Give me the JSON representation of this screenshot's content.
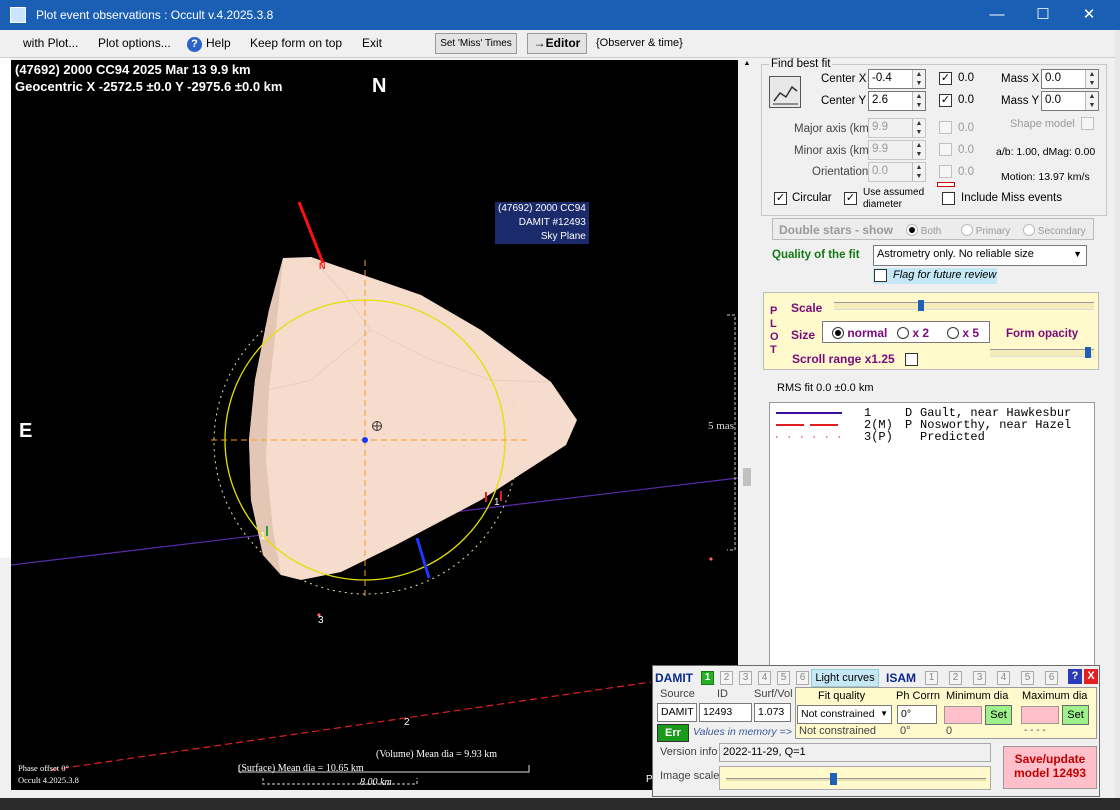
{
  "window": {
    "title": "Plot event observations : Occult v.4.2025.3.8",
    "minimize": "—",
    "maximize": "☐",
    "close": "✕"
  },
  "menu": {
    "with_plot": "with Plot...",
    "plot_options": "Plot options...",
    "help": "Help",
    "keep_on_top": "Keep form on top",
    "exit": "Exit",
    "set_miss_times": "Set 'Miss' Times",
    "editor": "→Editor",
    "observer_time": "{Observer & time}"
  },
  "plot": {
    "header_line1": "(47692) 2000 CC94  2025 Mar 13  9.9 km",
    "header_line2": "Geocentric  X  -2572.5 ±0.0  Y -2975.6 ±0.0 km",
    "north": "N",
    "east": "E",
    "info_line1": "(47692) 2000 CC94",
    "info_line2": "DAMIT #12493",
    "info_line3": "Sky Plane",
    "scale_mas": "5 mas",
    "phase_offset": "Phase offset 0°",
    "occult_version": "Occult 4.2025.3.8",
    "volume_dia": "(Volume) Mean dia = 9.93 km",
    "surface_dia": "(Surface) Mean dia = 10.65 km",
    "scale_km": "8.00 km",
    "pole_n": "N",
    "chord_label_1a": "1",
    "chord_label_1b": "1",
    "chord_label_2": "2",
    "chord_label_3": "3",
    "edge_letter": "P"
  },
  "fit": {
    "group_title": "Find best fit",
    "center_x_label": "Center X",
    "center_x": "-0.4",
    "center_y_label": "Center Y",
    "center_y": "2.6",
    "center_x_chk_val": "0.0",
    "center_y_chk_val": "0.0",
    "mass_x_label": "Mass X",
    "mass_x": "0.0",
    "mass_y_label": "Mass Y",
    "mass_y": "0.0",
    "major_label": "Major axis (km)",
    "major": "9.9",
    "minor_label": "Minor axis (km)",
    "minor": "9.9",
    "orientation_label": "Orientation",
    "orientation": "0.0",
    "major_chk_val": "0.0",
    "minor_chk_val": "0.0",
    "orient_chk_val": "0.0",
    "shape_model": "Shape model",
    "ab": "a/b: 1.00, dMag: 0.00",
    "motion": "Motion: 13.97 km/s",
    "circular": "Circular",
    "use_assumed": "Use assumed diameter",
    "include_miss": "Include Miss events",
    "double_stars": "Double stars - show",
    "both": "Both",
    "primary": "Primary",
    "secondary": "Secondary",
    "quality_label": "Quality of the fit",
    "quality_value": "Astrometry only. No reliable size",
    "flag_review": "Flag for future review"
  },
  "plot_panel": {
    "side_label": "PLOT",
    "scale": "Scale",
    "size": "Size",
    "normal": "normal",
    "x2": "x 2",
    "x5": "x 5",
    "form_opacity": "Form opacity",
    "scroll_range": "Scroll range x1.25",
    "scale_slider": 0.33,
    "opacity_slider": 0.97
  },
  "rms": "RMS fit 0.0 ±0.0 km",
  "legend": [
    {
      "num": "1",
      "code": "D",
      "name": "Gault, near Hawkesbur",
      "color": "#3a0fa0"
    },
    {
      "num": "2(M)",
      "code": "P",
      "name": "Nosworthy, near Hazel",
      "color": "#e02020"
    },
    {
      "num": "3(P)",
      "code": "",
      "name": "Predicted",
      "color": "#e06060"
    }
  ],
  "damit": {
    "title": "DAMIT",
    "nums": [
      "1",
      "2",
      "3",
      "4",
      "5",
      "6"
    ],
    "light_curves": "Light curves",
    "isam": "ISAM",
    "isam_nums": [
      "1",
      "2",
      "3",
      "4",
      "5",
      "6"
    ],
    "help": "?",
    "close": "X",
    "source_label": "Source",
    "id_label": "ID",
    "surfvol_label": "Surf/Vol",
    "source": "DAMIT",
    "id": "12493",
    "surfvol": "1.073",
    "fit_quality_label": "Fit quality",
    "ph_corrn_label": "Ph Corrn",
    "min_dia_label": "Minimum dia",
    "max_dia_label": "Maximum dia",
    "fit_quality": "Not constrained",
    "ph_corrn": "0°",
    "set": "Set",
    "err": "Err",
    "values_memory": "Values in memory =>",
    "mem_fit": "Not constrained",
    "mem_ph": "0°",
    "mem_min": "0",
    "mem_max": "- - - -",
    "version_label": "Version info",
    "version": "2022-11-29, Q=1",
    "image_scale_label": "Image scale",
    "image_scale": 0.41,
    "save_update": "Save/update model 12493"
  }
}
